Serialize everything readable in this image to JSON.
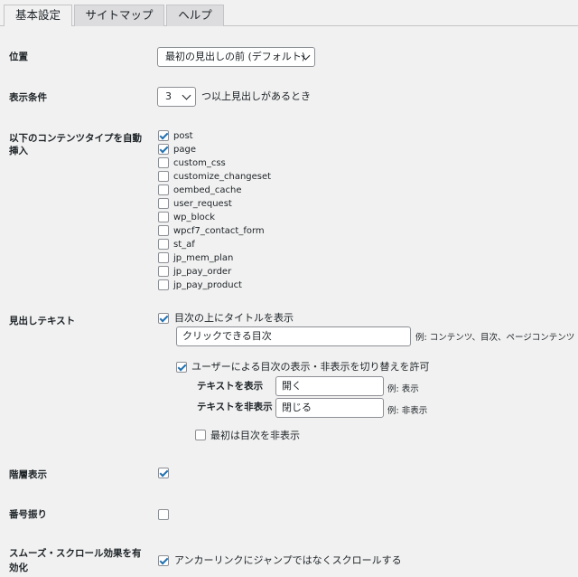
{
  "tabs": [
    "基本設定",
    "サイトマップ",
    "ヘルプ"
  ],
  "position": {
    "label": "位置",
    "value": "最初の見出しの前 (デフォルト)"
  },
  "display_condition": {
    "label": "表示条件",
    "value": "3",
    "suffix": "つ以上見出しがあるとき"
  },
  "auto_insert": {
    "label_line1": "以下のコンテンツタイプを自動",
    "label_line2": "挿入",
    "items": [
      {
        "name": "post",
        "checked": true
      },
      {
        "name": "page",
        "checked": true
      },
      {
        "name": "custom_css",
        "checked": false
      },
      {
        "name": "customize_changeset",
        "checked": false
      },
      {
        "name": "oembed_cache",
        "checked": false
      },
      {
        "name": "user_request",
        "checked": false
      },
      {
        "name": "wp_block",
        "checked": false
      },
      {
        "name": "wpcf7_contact_form",
        "checked": false
      },
      {
        "name": "st_af",
        "checked": false
      },
      {
        "name": "jp_mem_plan",
        "checked": false
      },
      {
        "name": "jp_pay_order",
        "checked": false
      },
      {
        "name": "jp_pay_product",
        "checked": false
      }
    ]
  },
  "heading_text": {
    "label": "見出しテキスト",
    "show_title_label": "目次の上にタイトルを表示",
    "title_value": "クリックできる目次",
    "title_hint": "例: コンテンツ、目次、ページコンテンツ",
    "toggle_label": "ユーザーによる目次の表示・非表示を切り替えを許可",
    "show_text_label": "テキストを表示",
    "show_text_value": "開く",
    "show_text_hint": "例: 表示",
    "hide_text_label": "テキストを非表示",
    "hide_text_value": "閉じる",
    "hide_text_hint": "例: 非表示",
    "initially_hidden_label": "最初は目次を非表示"
  },
  "hierarchy": {
    "label": "階層表示"
  },
  "numbering": {
    "label": "番号振り"
  },
  "smooth_scroll": {
    "label_line1": "スムーズ・スクロール効果を有",
    "label_line2": "効化",
    "option_label": "アンカーリンクにジャンプではなくスクロールする"
  }
}
